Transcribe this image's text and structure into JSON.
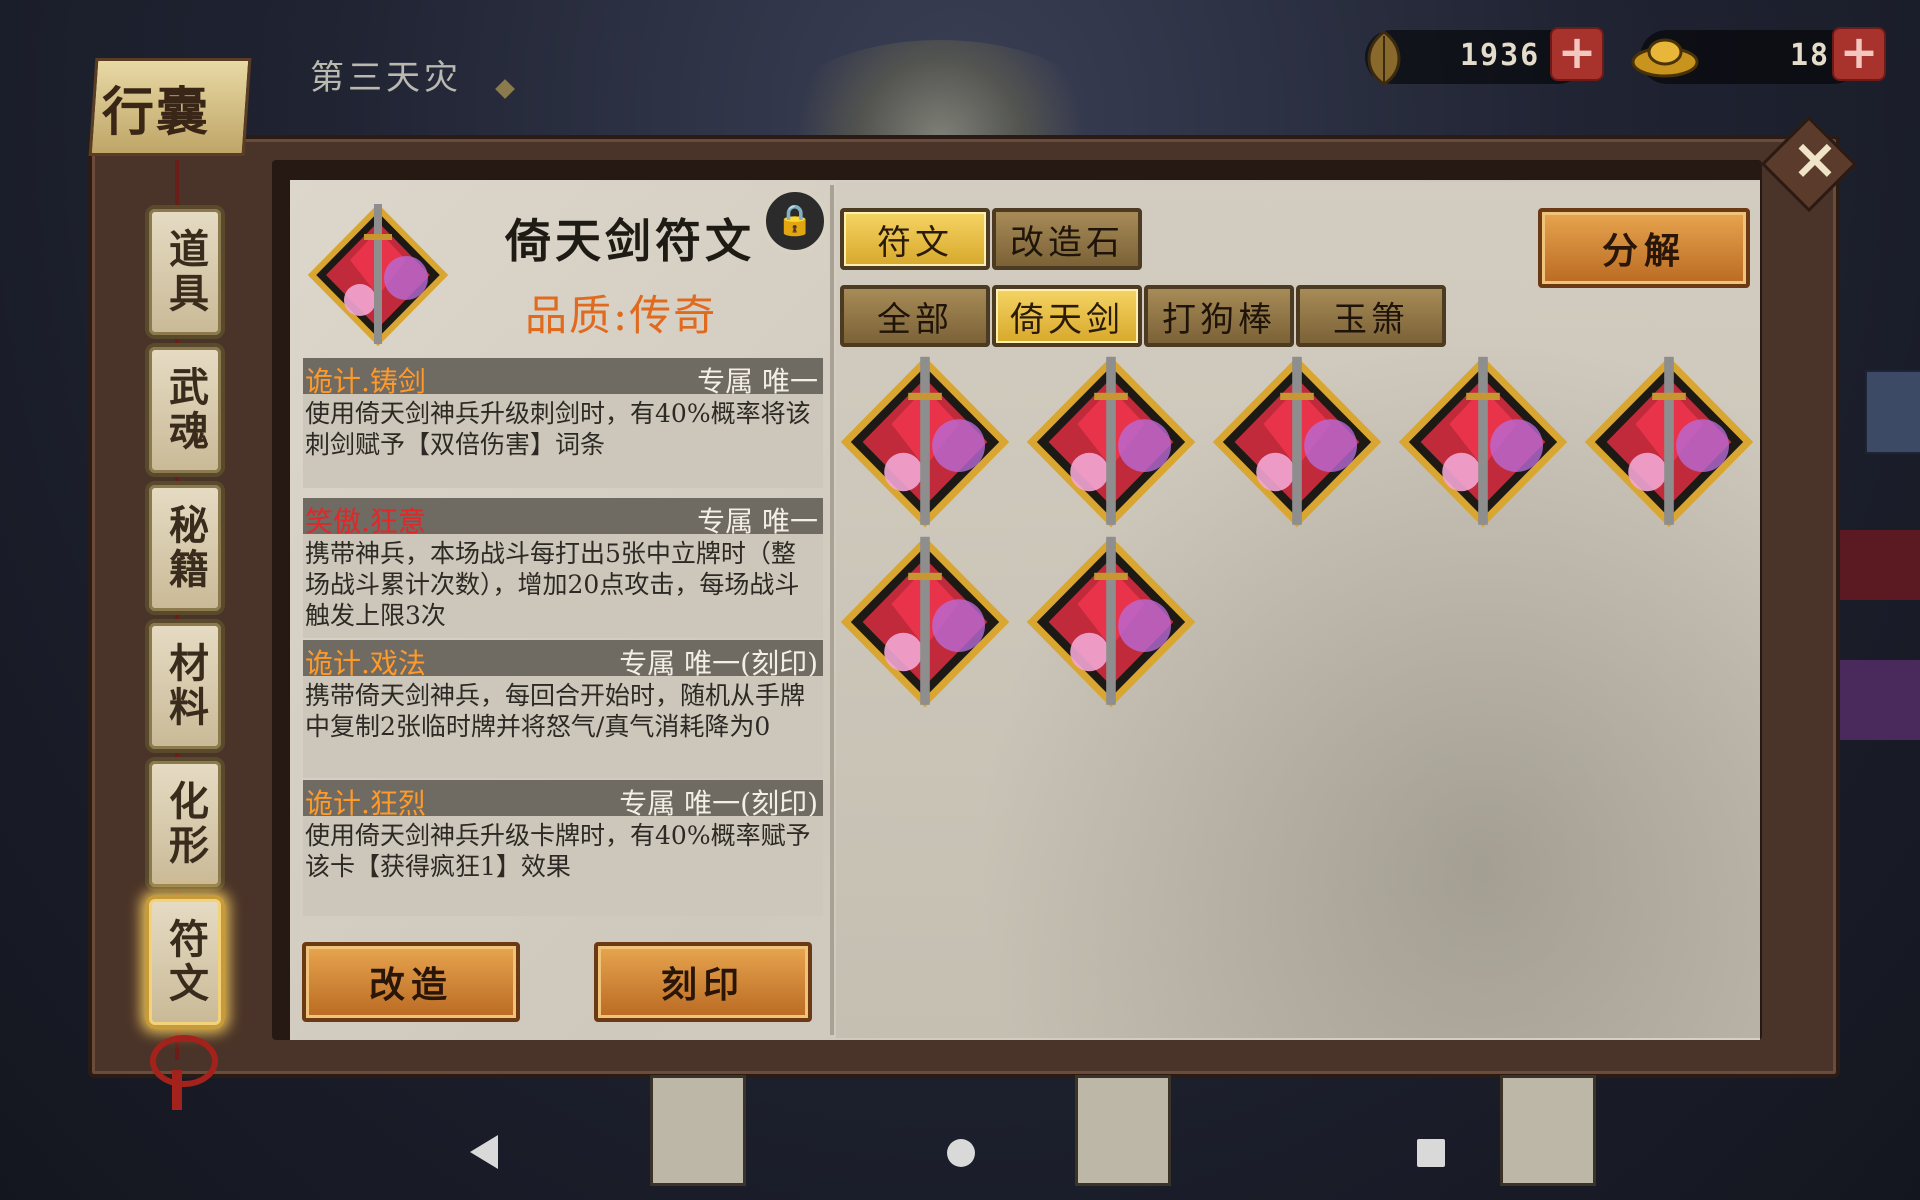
{
  "header": {
    "chapter": "第三天灾",
    "title": "行囊"
  },
  "currencies": [
    {
      "icon": "leaf-icon",
      "value": "1936"
    },
    {
      "icon": "gold-ingot-icon",
      "value": "18"
    }
  ],
  "side_tabs": [
    {
      "label": "道具",
      "active": false
    },
    {
      "label": "武魂",
      "active": false
    },
    {
      "label": "秘籍",
      "active": false
    },
    {
      "label": "材料",
      "active": false
    },
    {
      "label": "化形",
      "active": false
    },
    {
      "label": "符文",
      "active": true
    }
  ],
  "detail": {
    "name": "倚天剑符文",
    "quality": "品质:传奇",
    "skills": [
      {
        "name": "诡计.铸剑",
        "tag": "专属 唯一",
        "desc": "使用倚天剑神兵升级刺剑时，有40%概率将该刺剑赋予【双倍伤害】词条"
      },
      {
        "name": "笑傲.狂意",
        "tag": "专属 唯一",
        "desc": "携带神兵，本场战斗每打出5张中立牌时（整场战斗累计次数），增加20点攻击，每场战斗触发上限3次"
      },
      {
        "name": "诡计.戏法",
        "tag": "专属 唯一(刻印)",
        "desc": "携带倚天剑神兵，每回合开始时，随机从手牌中复制2张临时牌并将怒气/真气消耗降为0"
      },
      {
        "name": "诡计.狂烈",
        "tag": "专属 唯一(刻印)",
        "desc": "使用倚天剑神兵升级卡牌时，有40%概率赋予该卡【获得疯狂1】效果"
      }
    ],
    "buttons": {
      "modify": "改造",
      "engrave": "刻印"
    }
  },
  "tabs_top": [
    {
      "label": "符文",
      "active": true
    },
    {
      "label": "改造石",
      "active": false
    }
  ],
  "tabs_filter": [
    {
      "label": "全部",
      "active": false
    },
    {
      "label": "倚天剑",
      "active": true
    },
    {
      "label": "打狗棒",
      "active": false
    },
    {
      "label": "玉箫",
      "active": false
    }
  ],
  "decompose_label": "分解",
  "inventory": {
    "count": 7,
    "item_icon": "yitian-sword-rune-icon"
  },
  "colors": {
    "accent_orange": "#e06a1e",
    "skill_orange": "#ff9a2a",
    "skill_red": "#e02828",
    "tab_gold": "#f5d464"
  }
}
